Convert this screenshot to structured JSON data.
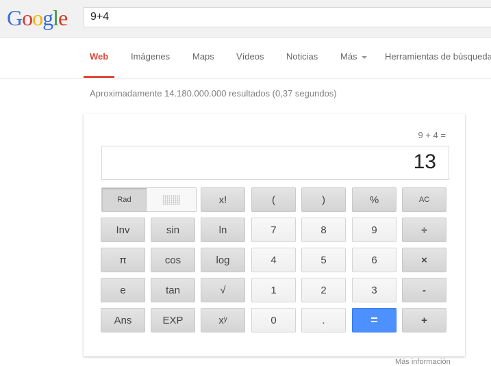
{
  "logo": {
    "letters": [
      "G",
      "o",
      "o",
      "g",
      "l",
      "e"
    ],
    "colors": [
      "#3b6fd8",
      "#d53a2b",
      "#f2b400",
      "#3b6fd8",
      "#2d9a44",
      "#d53a2b"
    ]
  },
  "search": {
    "value": "9+4"
  },
  "nav": {
    "items": [
      "Web",
      "Imágenes",
      "Maps",
      "Vídeos",
      "Noticias",
      "Más",
      "Herramientas de búsqueda"
    ],
    "active_color": "#dd4b39"
  },
  "results": {
    "stats": "Aproximadamente 14.180.000.000 resultados (0,37 segundos)"
  },
  "calculator": {
    "expression": "9 + 4 =",
    "display": "13",
    "mode_label": "Rad",
    "buttons": {
      "fact": "x!",
      "lparen": "(",
      "rparen": ")",
      "percent": "%",
      "ac": "AC",
      "inv": "Inv",
      "sin": "sin",
      "ln": "ln",
      "seven": "7",
      "eight": "8",
      "nine": "9",
      "divide": "÷",
      "pi": "π",
      "cos": "cos",
      "log": "log",
      "four": "4",
      "five": "5",
      "six": "6",
      "multiply": "×",
      "e": "e",
      "tan": "tan",
      "sqrt": "√",
      "one": "1",
      "two": "2",
      "three": "3",
      "minus": "-",
      "ans": "Ans",
      "exp": "EXP",
      "power": "xʸ",
      "zero": "0",
      "dot": ".",
      "equals": "=",
      "plus": "+"
    },
    "equals_color": "#4d90fe"
  },
  "footer": {
    "more_info": "Más información"
  }
}
